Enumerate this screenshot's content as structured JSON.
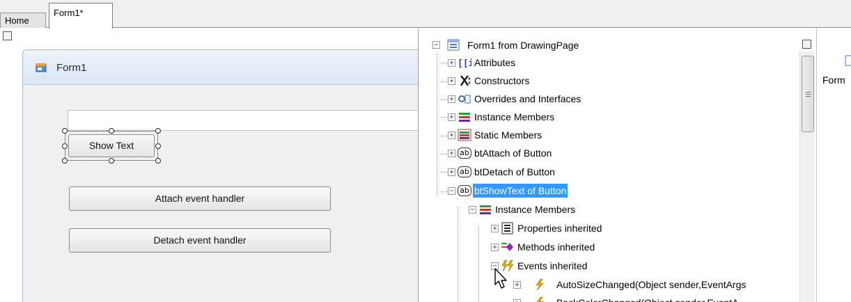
{
  "tabs": [
    {
      "label": "Home",
      "active": false
    },
    {
      "label": "Form1*",
      "active": true
    }
  ],
  "designer": {
    "form_title": "Form1",
    "textbox_value": "",
    "buttons": {
      "show_text": "Show Text",
      "attach": "Attach event handler",
      "detach": "Detach event handler"
    }
  },
  "tree": {
    "root": "Form1 from DrawingPage",
    "items": [
      "Attributes",
      "Constructors",
      "Overrides and Interfaces",
      "Instance Members",
      "Static Members",
      "btAttach of Button",
      "btDetach of Button",
      "btShowText of Button"
    ],
    "children": {
      "instance_members": "Instance Members",
      "properties": "Properties inherited",
      "methods": "Methods inherited",
      "events": "Events inherited",
      "event_items": [
        "AutoSizeChanged(Object sender,EventArgs",
        "BackColorChanged(Object sender,EventA"
      ]
    },
    "icons": {
      "ab": "ab"
    }
  },
  "right_panel": {
    "label": "Form"
  },
  "colors": {
    "selection": "#3399ff",
    "lightning": "#e0b000"
  }
}
